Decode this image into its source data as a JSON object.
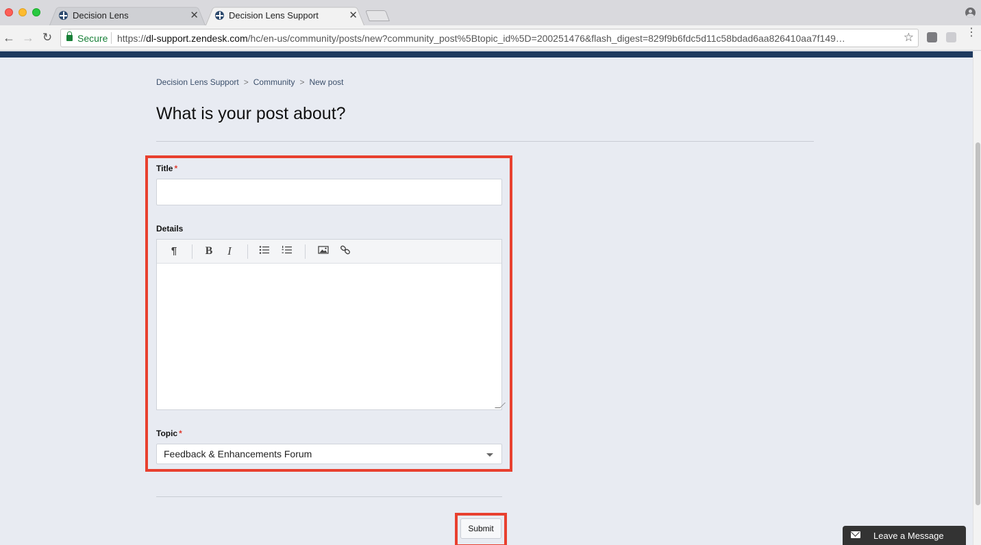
{
  "browser": {
    "tabs": [
      {
        "label": "Decision Lens",
        "close": "✕"
      },
      {
        "label": "Decision Lens Support",
        "close": "✕"
      }
    ],
    "address": {
      "secure_label": "Secure",
      "url_prefix": "https://",
      "url_host": "dl-support.zendesk.com",
      "url_path": "/hc/en-us/community/posts/new?community_post%5Btopic_id%5D=200251476&flash_digest=829f9b6fdc5d11c58bdad6aa826410aa7f149…"
    },
    "icons": [
      "back-icon",
      "forward-icon",
      "reload-icon",
      "lock-icon",
      "star-icon",
      "extension-icon",
      "menu-icon",
      "profile-icon"
    ]
  },
  "breadcrumb": {
    "items": [
      "Decision Lens Support",
      "Community",
      "New post"
    ],
    "separator": ">"
  },
  "page": {
    "title": "What is your post about?"
  },
  "form": {
    "title_label": "Title",
    "required_mark": "*",
    "details_label": "Details",
    "editor_toolbar": {
      "paragraph": "¶",
      "bold": "B",
      "italic": "I"
    },
    "topic_label": "Topic",
    "topic_value": "Feedback & Enhancements Forum",
    "submit_label": "Submit"
  },
  "widget": {
    "leave_message_label": "Leave a Message"
  },
  "colors": {
    "highlight": "#e8402f",
    "header": "#1f3a5f",
    "background": "#e8ebf2"
  }
}
